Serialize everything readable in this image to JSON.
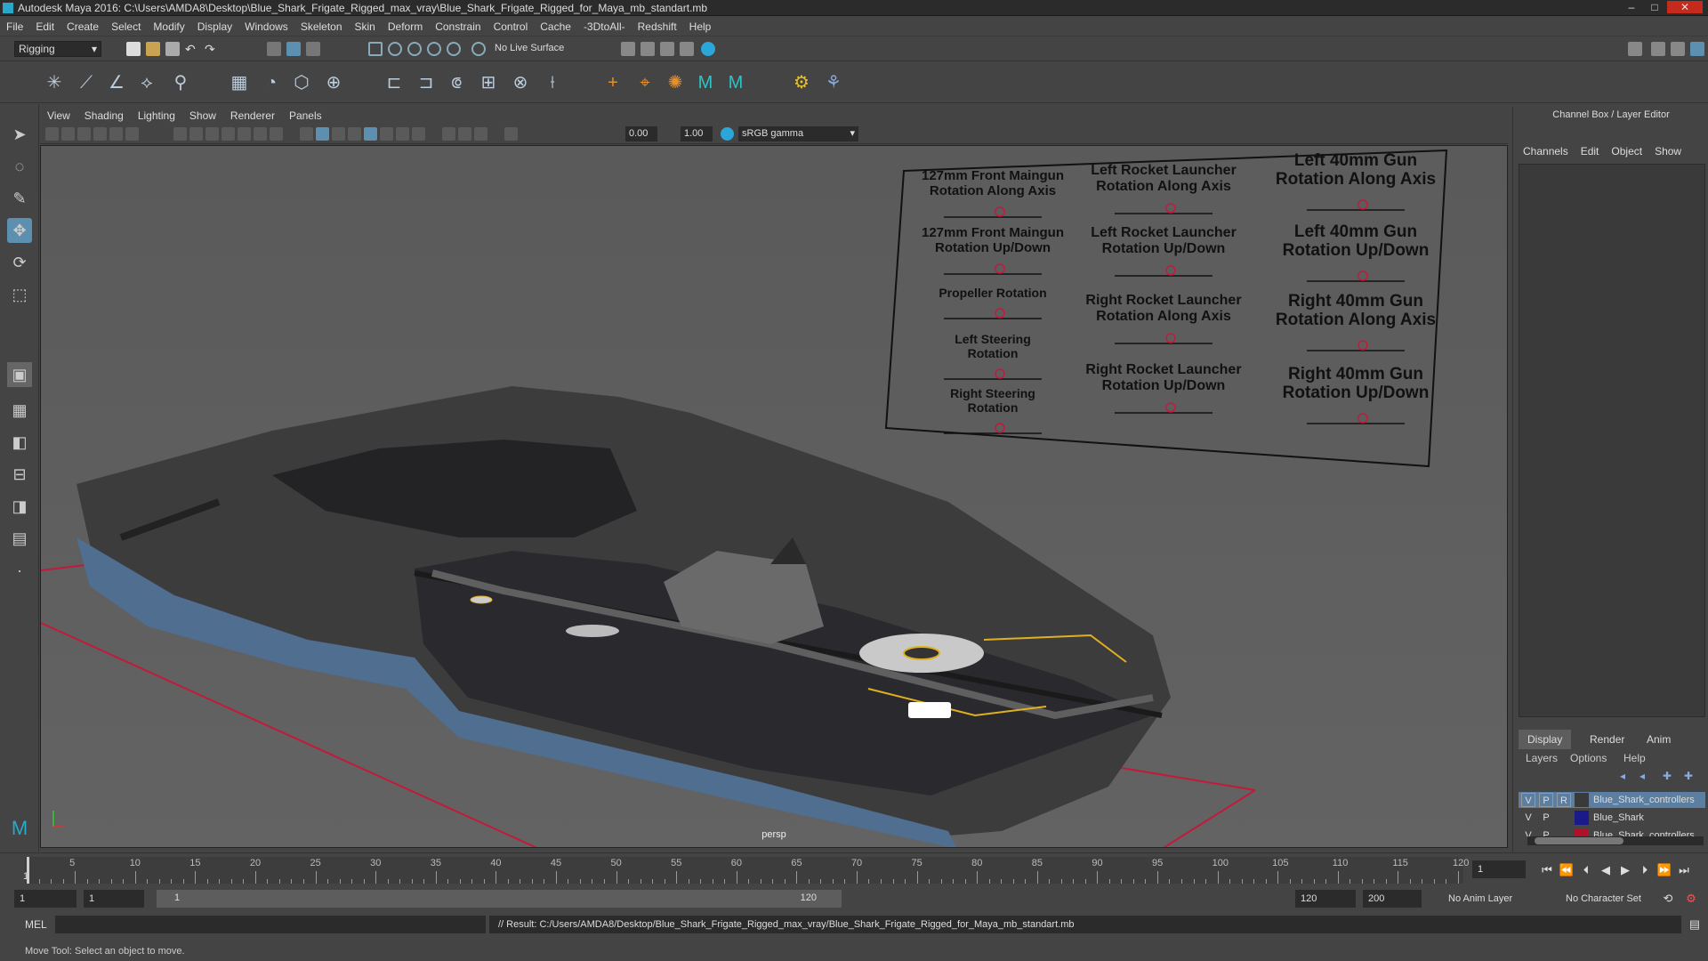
{
  "window": {
    "title": "Autodesk Maya 2016: C:\\Users\\AMDA8\\Desktop\\Blue_Shark_Frigate_Rigged_max_vray\\Blue_Shark_Frigate_Rigged_for_Maya_mb_standart.mb",
    "minimize": "–",
    "maximize": "□",
    "close": "✕"
  },
  "menu": [
    "File",
    "Edit",
    "Create",
    "Select",
    "Modify",
    "Display",
    "Windows",
    "Skeleton",
    "Skin",
    "Deform",
    "Constrain",
    "Control",
    "Cache",
    "-3DtoAll-",
    "Redshift",
    "Help"
  ],
  "status": {
    "menuset": "Rigging",
    "live_surface": "No Live Surface"
  },
  "viewport": {
    "menu": [
      "View",
      "Shading",
      "Lighting",
      "Show",
      "Renderer",
      "Panels"
    ],
    "exposure": "0.00",
    "gamma": "1.00",
    "color_space": "sRGB gamma",
    "camera": "persp"
  },
  "control_panel": [
    {
      "label": [
        "127mm Front Maingun",
        "Rotation Along Axis"
      ]
    },
    {
      "label": [
        "Left Rocket Launcher",
        "Rotation Along Axis"
      ]
    },
    {
      "label": [
        "Left 40mm Gun",
        "Rotation Along Axis"
      ]
    },
    {
      "label": [
        "127mm Front Maingun",
        "Rotation Up/Down"
      ]
    },
    {
      "label": [
        "Left Rocket Launcher",
        "Rotation Up/Down"
      ]
    },
    {
      "label": [
        "Left 40mm Gun",
        "Rotation Up/Down"
      ]
    },
    {
      "label": [
        "Propeller Rotation"
      ]
    },
    {
      "label": [
        "Right Rocket Launcher",
        "Rotation Along Axis"
      ]
    },
    {
      "label": [
        "Right 40mm Gun",
        "Rotation Along Axis"
      ]
    },
    {
      "label": [
        "Left Steering",
        "Rotation"
      ]
    },
    {
      "label": [
        "Right Rocket Launcher",
        "Rotation Up/Down"
      ]
    },
    {
      "label": [
        "Right 40mm Gun",
        "Rotation Up/Down"
      ]
    },
    {
      "label": [
        "Right Steering",
        "Rotation"
      ]
    }
  ],
  "channel_box": {
    "title": "Channel Box / Layer Editor",
    "menu": [
      "Channels",
      "Edit",
      "Object",
      "Show"
    ],
    "layer_tabs": [
      "Display",
      "Render",
      "Anim"
    ],
    "layer_menu": [
      "Layers",
      "Options",
      "Help"
    ],
    "layers": [
      {
        "v": "V",
        "p": "P",
        "r": "R",
        "name": "Blue_Shark_controllers",
        "color": "#3a3a3a",
        "selected": true
      },
      {
        "v": "V",
        "p": "P",
        "r": "",
        "name": "Blue_Shark",
        "color": "#1a1a8a",
        "selected": false
      },
      {
        "v": "V",
        "p": "P",
        "r": "",
        "name": "Blue_Shark_controllers",
        "color": "#b0102a",
        "selected": false
      }
    ]
  },
  "timeline": {
    "labels": [
      "5",
      "10",
      "15",
      "20",
      "25",
      "30",
      "35",
      "40",
      "45",
      "50",
      "55",
      "60",
      "65",
      "70",
      "75",
      "80",
      "85",
      "90",
      "95",
      "100",
      "105",
      "110",
      "115",
      "120"
    ],
    "start_tick": "1",
    "current_frame": "1"
  },
  "range": {
    "start": "1",
    "start2": "1",
    "slider_start": "1",
    "slider_end": "120",
    "end": "120",
    "end2": "200",
    "anim_layer": "No Anim Layer",
    "character_set": "No Character Set"
  },
  "command": {
    "lang": "MEL",
    "result": "// Result: C:/Users/AMDA8/Desktop/Blue_Shark_Frigate_Rigged_max_vray/Blue_Shark_Frigate_Rigged_for_Maya_mb_standart.mb"
  },
  "help": "Move Tool: Select an object to move."
}
